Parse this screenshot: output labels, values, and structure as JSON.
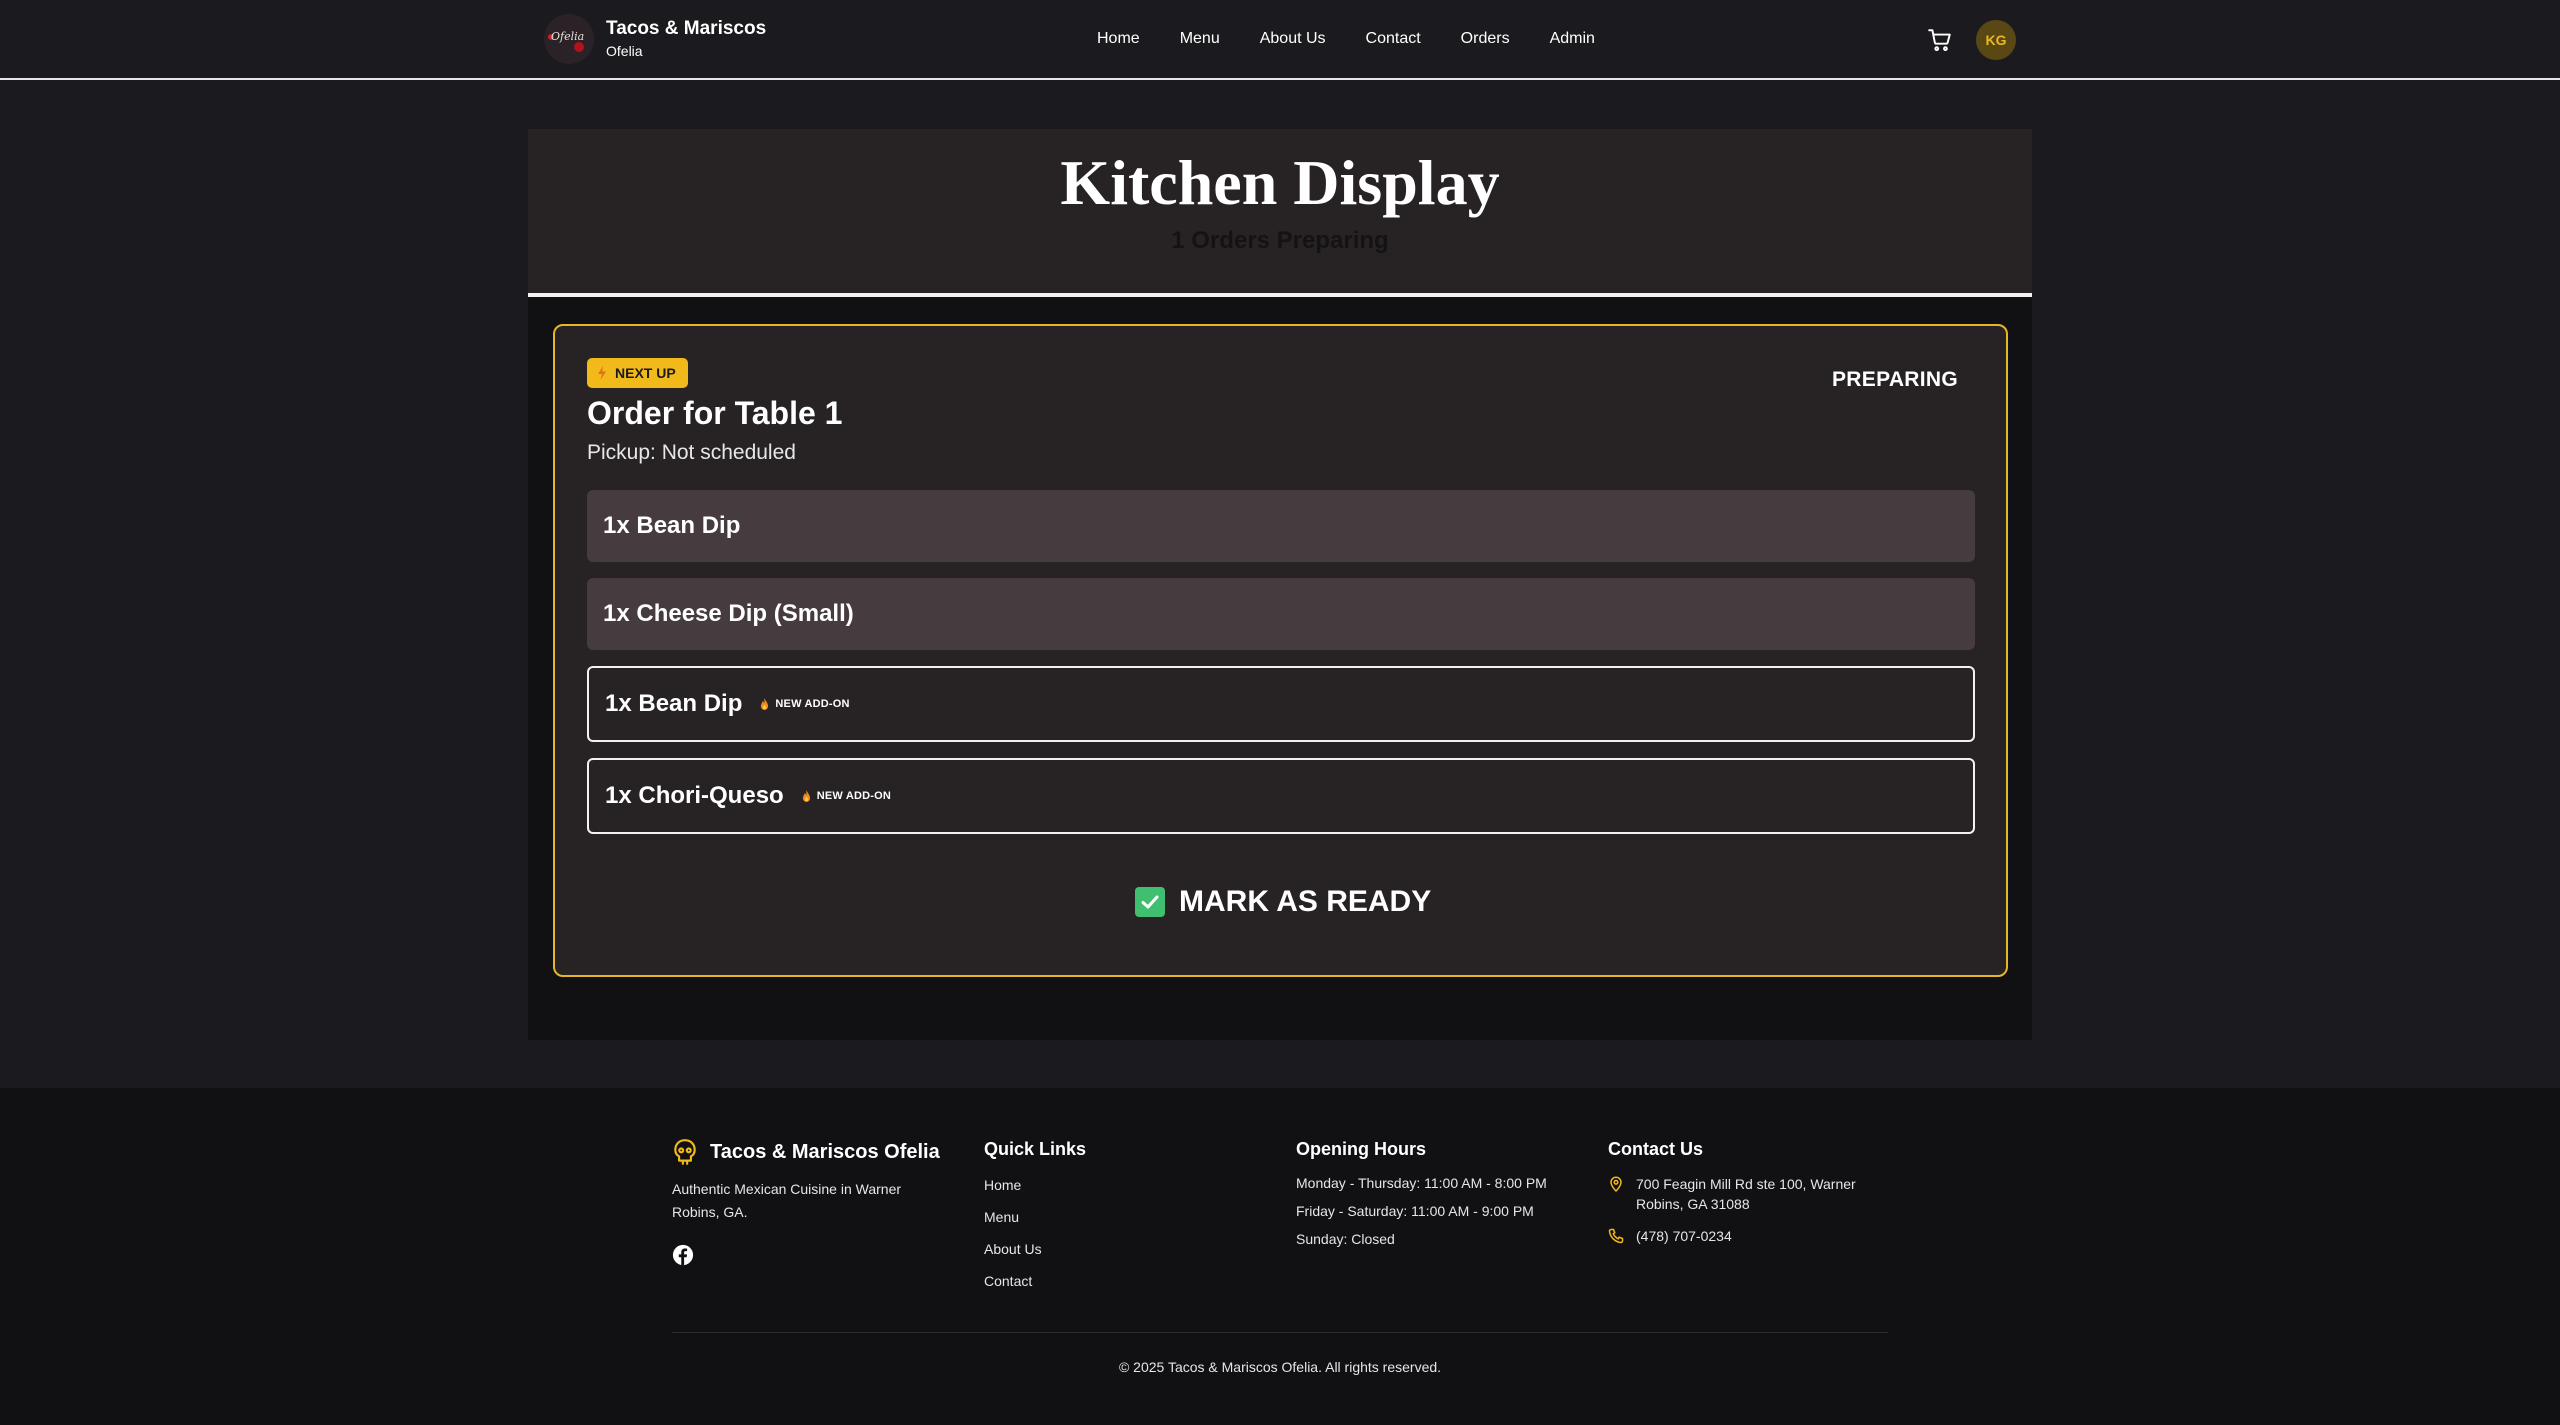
{
  "header": {
    "brand_title": "Tacos & Mariscos",
    "brand_subtitle": "Ofelia",
    "logo_text": "Ofelia",
    "nav": [
      "Home",
      "Menu",
      "About Us",
      "Contact",
      "Orders",
      "Admin"
    ],
    "avatar_initials": "KG"
  },
  "kitchen": {
    "title": "Kitchen Display",
    "orders_count_text": "1 Orders Preparing"
  },
  "order": {
    "badge": "NEXT UP",
    "status": "PREPARING",
    "title": "Order for Table 1",
    "pickup": "Pickup: Not scheduled",
    "items": [
      {
        "text": "1x Bean Dip",
        "addon": false
      },
      {
        "text": "1x Cheese Dip (Small)",
        "addon": false
      },
      {
        "text": "1x Bean Dip",
        "addon": true
      },
      {
        "text": "1x Chori-Queso",
        "addon": true
      }
    ],
    "addon_label": "NEW ADD-ON",
    "ready_button": "MARK AS READY"
  },
  "footer": {
    "brand": "Tacos & Mariscos Ofelia",
    "description": "Authentic Mexican Cuisine in Warner Robins, GA.",
    "quick_links_title": "Quick Links",
    "quick_links": [
      "Home",
      "Menu",
      "About Us",
      "Contact"
    ],
    "hours_title": "Opening Hours",
    "hours": [
      "Monday - Thursday: 11:00 AM - 8:00 PM",
      "Friday - Saturday: 11:00 AM - 9:00 PM",
      "Sunday: Closed"
    ],
    "contact_title": "Contact Us",
    "address": "700 Feagin Mill Rd ste 100, Warner Robins, GA 31088",
    "phone": "(478) 707-0234",
    "copyright": "© 2025 Tacos & Mariscos Ofelia. All rights reserved."
  },
  "colors": {
    "accent_yellow": "#f1b91a",
    "card_border": "#e4b62a",
    "success_green": "#3fbf6f",
    "item_bg": "#463b3f"
  },
  "icons": [
    "cart-icon",
    "lightning-icon",
    "flame-icon",
    "check-icon",
    "skull-icon",
    "facebook-icon",
    "map-pin-icon",
    "phone-icon"
  ]
}
